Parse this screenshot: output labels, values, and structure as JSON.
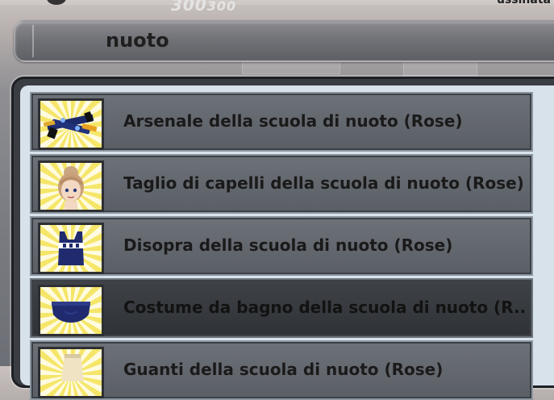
{
  "header": {
    "numbers": "300",
    "numbers_sub": "300",
    "right_text": "ussinata"
  },
  "search": {
    "value": "nuoto"
  },
  "results": [
    {
      "label": "Arsenale della scuola di nuoto (Rose)",
      "icon": "weapons-icon"
    },
    {
      "label": "Taglio di capelli della scuola di nuoto (Rose)",
      "icon": "hair-portrait-icon"
    },
    {
      "label": "Disopra della scuola di nuoto (Rose)",
      "icon": "swim-top-icon"
    },
    {
      "label": "Costume da bagno della scuola di nuoto (R..",
      "icon": "swim-bottom-icon",
      "selected": true
    },
    {
      "label": "Guanti della scuola di nuoto (Rose)",
      "icon": "gloves-icon"
    }
  ]
}
